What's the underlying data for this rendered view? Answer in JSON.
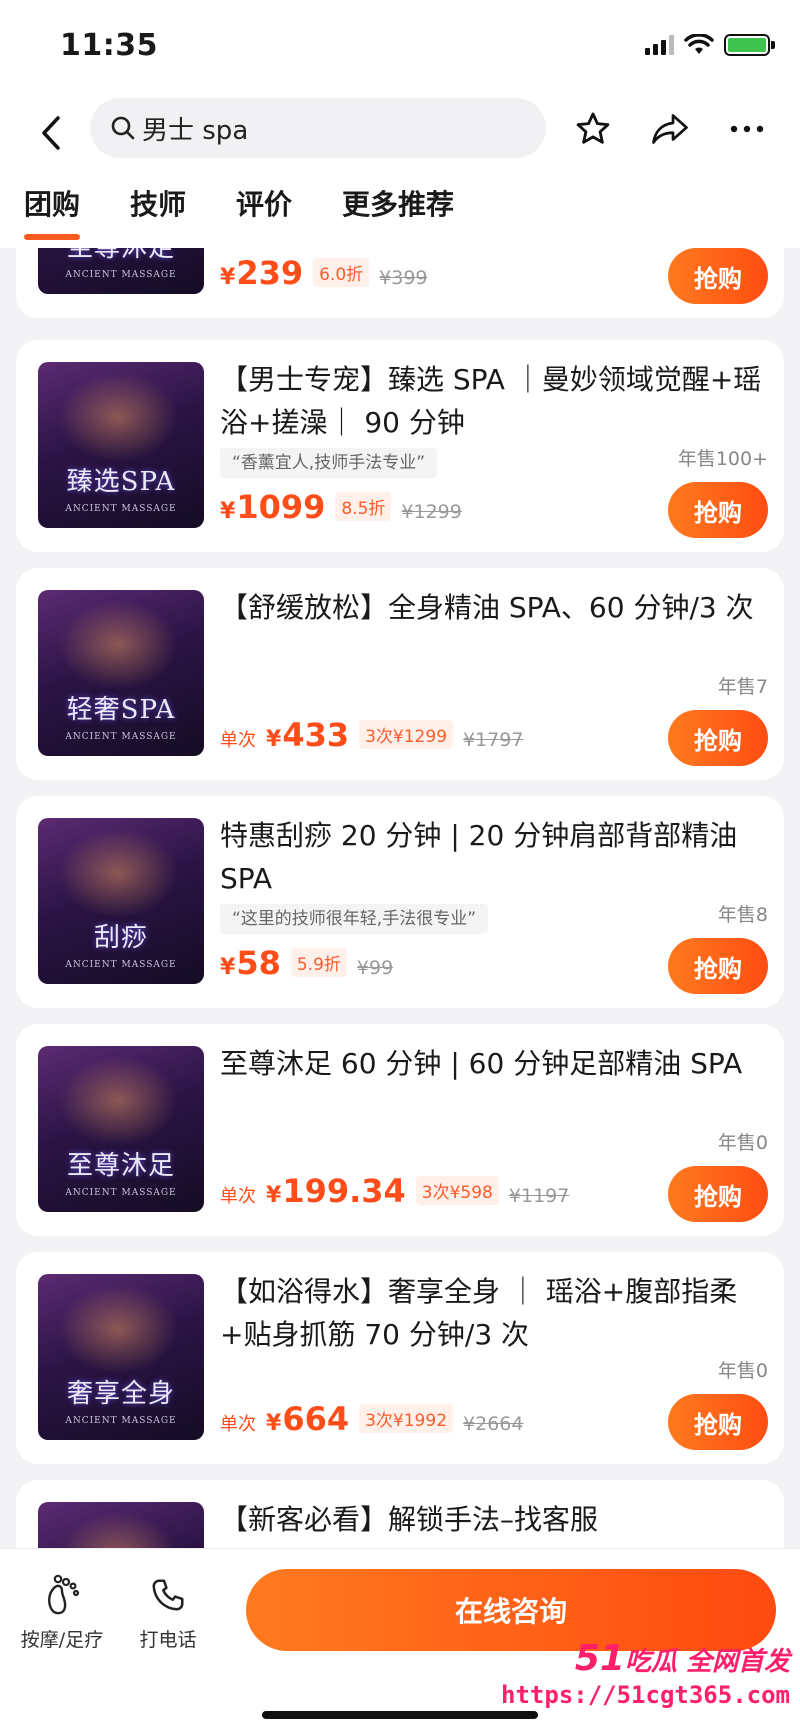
{
  "status_bar": {
    "time": "11:35"
  },
  "search": {
    "query": "男士 spa"
  },
  "tabs": [
    {
      "label": "团购",
      "active": true
    },
    {
      "label": "技师",
      "active": false
    },
    {
      "label": "评价",
      "active": false
    },
    {
      "label": "更多推荐",
      "active": false
    }
  ],
  "deals": [
    {
      "thumb_title": "至尊沐足",
      "thumb_sub": "ANCIENT MASSAGE",
      "title": "",
      "quote": "",
      "per_label": "",
      "price": "239",
      "discount": "6.0折",
      "original_price": "¥399",
      "sold": "",
      "buy_label": "抢购"
    },
    {
      "thumb_title": "臻选SPA",
      "thumb_sub": "ANCIENT MASSAGE",
      "title": "【男士专宠】臻选 SPA ｜曼妙领域觉醒+瑶浴+搓澡｜ 90 分钟",
      "quote": "“香薰宜人,技师手法专业”",
      "per_label": "",
      "price": "1099",
      "discount": "8.5折",
      "original_price": "¥1299",
      "sold": "年售100+",
      "buy_label": "抢购"
    },
    {
      "thumb_title": "轻奢SPA",
      "thumb_sub": "ANCIENT MASSAGE",
      "title": "【舒缓放松】全身精油 SPA、60 分钟/3 次",
      "quote": "",
      "per_label": "单次",
      "price": "433",
      "discount": "3次¥1299",
      "original_price": "¥1797",
      "sold": "年售7",
      "buy_label": "抢购"
    },
    {
      "thumb_title": "刮痧",
      "thumb_sub": "ANCIENT MASSAGE",
      "title": "特惠刮痧 20 分钟 | 20 分钟肩部背部精油 SPA",
      "quote": "“这里的技师很年轻,手法很专业”",
      "per_label": "",
      "price": "58",
      "discount": "5.9折",
      "original_price": "¥99",
      "sold": "年售8",
      "buy_label": "抢购"
    },
    {
      "thumb_title": "至尊沐足",
      "thumb_sub": "ANCIENT MASSAGE",
      "title": "至尊沐足 60 分钟 | 60 分钟足部精油 SPA",
      "quote": "",
      "per_label": "单次",
      "price": "199.34",
      "discount": "3次¥598",
      "original_price": "¥1197",
      "sold": "年售0",
      "buy_label": "抢购"
    },
    {
      "thumb_title": "奢享全身",
      "thumb_sub": "ANCIENT MASSAGE",
      "title": "【如浴得水】奢享全身 ｜ 瑶浴+腹部指柔+贴身抓筋 70 分钟/3 次",
      "quote": "",
      "per_label": "单次",
      "price": "664",
      "discount": "3次¥1992",
      "original_price": "¥2664",
      "sold": "年售0",
      "buy_label": "抢购"
    },
    {
      "thumb_title": "",
      "thumb_sub": "",
      "title": "【新客必看】解锁手法–找客服",
      "quote": "",
      "per_label": "",
      "price": "",
      "discount": "",
      "original_price": "",
      "sold": "",
      "buy_label": ""
    }
  ],
  "bottom_bar": {
    "massage_label": "按摩/足疗",
    "call_label": "打电话",
    "consult_label": "在线咨询"
  },
  "watermark": {
    "brand_num": "51",
    "brand_text": "吃瓜 全网首发",
    "url": "https://51cgt365.com"
  },
  "colors": {
    "accent": "#ff5a1f",
    "price": "#ff4d1a",
    "background": "#f3f3f5"
  },
  "icons": [
    "back-icon",
    "search-icon",
    "star-icon",
    "share-icon",
    "more-icon",
    "footprint-icon",
    "phone-icon"
  ]
}
